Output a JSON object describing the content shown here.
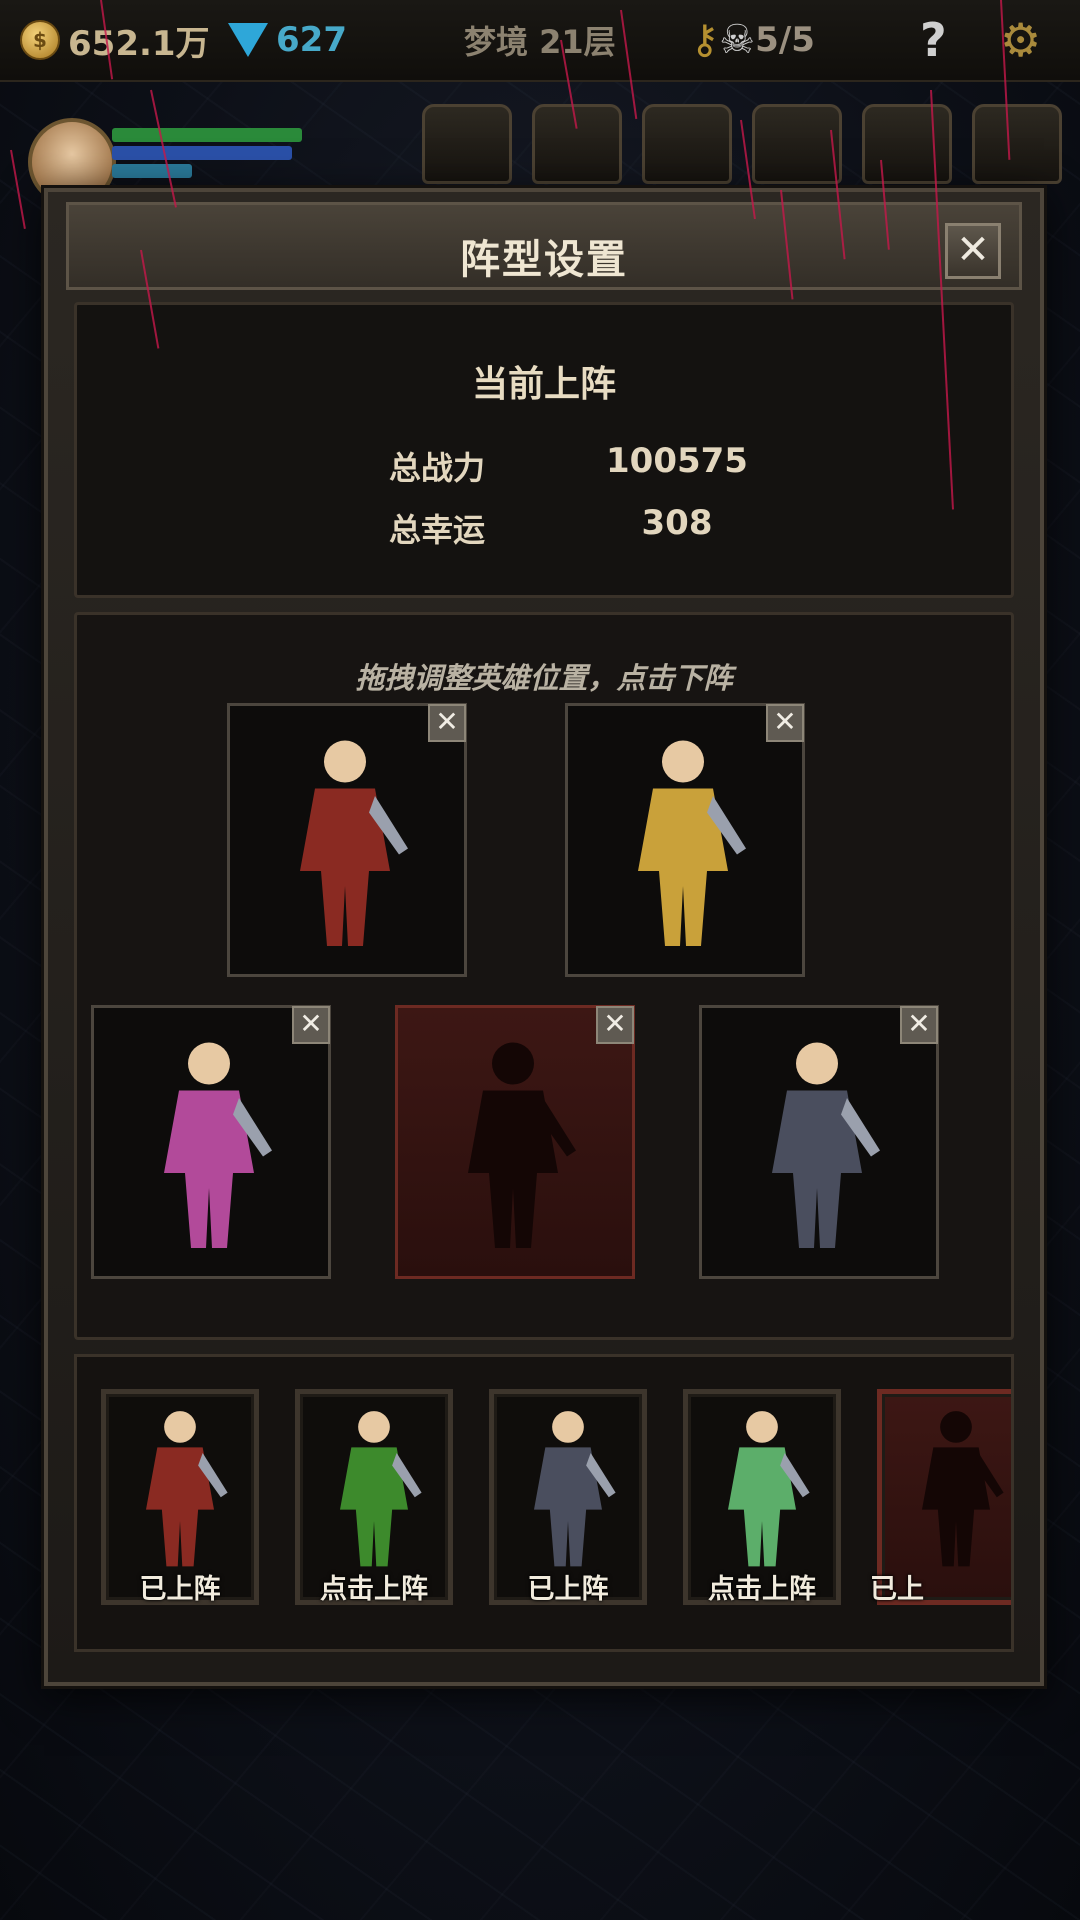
{
  "hud": {
    "gold": "652.1万",
    "gems": "627",
    "stage": "梦境 21层",
    "keys_skulls": "5/5",
    "help_icon": "question-mark-icon",
    "settings_icon": "gear-icon"
  },
  "dialog": {
    "title": "阵型设置",
    "close_label": "✕",
    "current_heading": "当前上阵",
    "power_label": "总战力",
    "power_value": "100575",
    "luck_label": "总幸运",
    "luck_value": "308",
    "hint": "拖拽调整英雄位置，点击下阵",
    "remove_label": "✕"
  },
  "formation": [
    {
      "hero": "crusader-knight",
      "empty": false,
      "color": "#8a2a22"
    },
    {
      "hero": "golden-priestess",
      "empty": false,
      "color": "#c9a13a"
    },
    {
      "hero": "pink-witch",
      "empty": false,
      "color": "#b24a9a"
    },
    {
      "hero": "empty-slot-silhouette",
      "empty": true,
      "color": "#3d1714"
    },
    {
      "hero": "dark-rogue",
      "empty": false,
      "color": "#4a4e5e"
    }
  ],
  "roster": [
    {
      "label": "已上阵",
      "hero": "crusader-knight",
      "empty": false,
      "color": "#8a2a22"
    },
    {
      "label": "点击上阵",
      "hero": "green-archer",
      "empty": false,
      "color": "#3d8a2c"
    },
    {
      "label": "已上阵",
      "hero": "dark-rogue",
      "empty": false,
      "color": "#4a4e5e"
    },
    {
      "label": "点击上阵",
      "hero": "jade-swordsman",
      "empty": false,
      "color": "#5cae6a"
    },
    {
      "label": "已上",
      "hero": "empty-slot-silhouette",
      "empty": true,
      "color": "#3d1714"
    }
  ]
}
